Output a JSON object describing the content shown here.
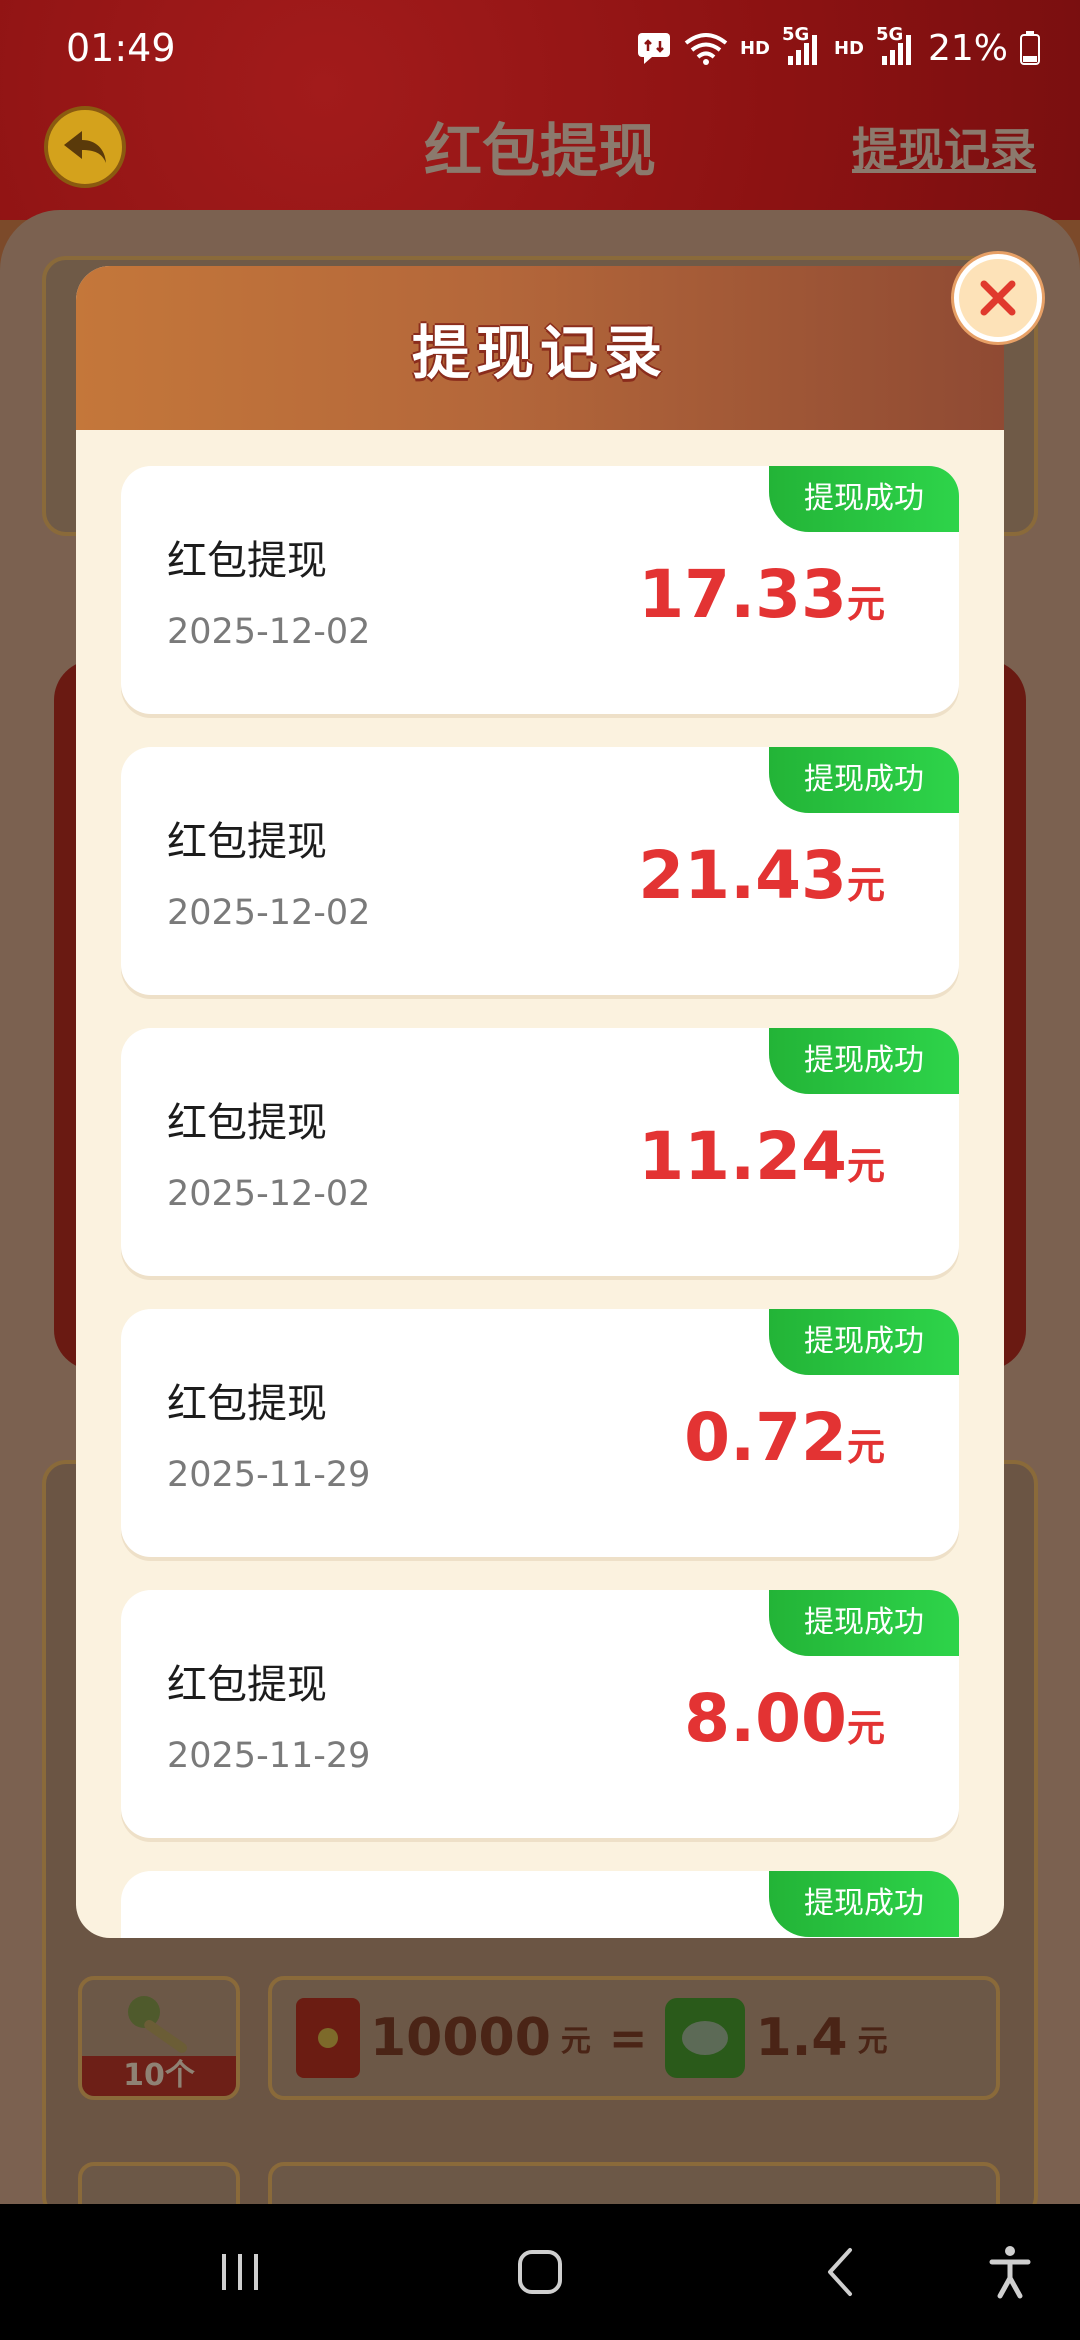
{
  "status_bar": {
    "time": "01:49",
    "hd1": "HD",
    "net1": "5G",
    "hd2": "HD",
    "net2": "5G",
    "battery": "21%"
  },
  "background": {
    "title": "红包提现",
    "records_link": "提现记录",
    "key_count": "10个",
    "rate_amount_left": "10000",
    "rate_unit_left": "元",
    "rate_equals": "=",
    "rate_amount_right": "1.4",
    "rate_unit_right": "元"
  },
  "modal": {
    "title": "提现记录",
    "records": [
      {
        "title": "红包提现",
        "date": "2025-12-02",
        "amount": "17.33",
        "unit": "元",
        "status": "提现成功"
      },
      {
        "title": "红包提现",
        "date": "2025-12-02",
        "amount": "21.43",
        "unit": "元",
        "status": "提现成功"
      },
      {
        "title": "红包提现",
        "date": "2025-12-02",
        "amount": "11.24",
        "unit": "元",
        "status": "提现成功"
      },
      {
        "title": "红包提现",
        "date": "2025-11-29",
        "amount": "0.72",
        "unit": "元",
        "status": "提现成功"
      },
      {
        "title": "红包提现",
        "date": "2025-11-29",
        "amount": "8.00",
        "unit": "元",
        "status": "提现成功"
      },
      {
        "title": "",
        "date": "",
        "amount": "",
        "unit": "",
        "status": "提现成功"
      }
    ]
  },
  "colors": {
    "accent_red": "#e33333",
    "success_green": "#2ed44a",
    "header_brown": "#b4673a"
  },
  "icons": {
    "back": "back-arrow-icon",
    "close": "close-icon",
    "wifi": "wifi-icon",
    "signal": "signal-icon",
    "battery": "battery-icon",
    "nav_recents": "recents-icon",
    "nav_home": "home-icon",
    "nav_back": "back-icon",
    "accessibility": "accessibility-icon"
  }
}
